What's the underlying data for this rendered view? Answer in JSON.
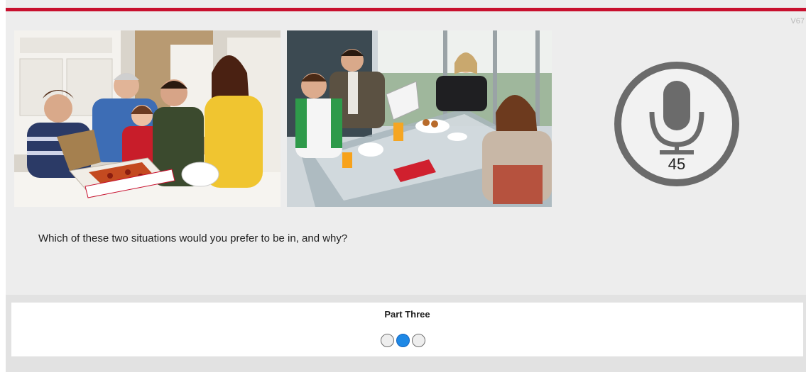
{
  "header": {
    "version": "V67",
    "accent_color": "#c8102e"
  },
  "prompt": {
    "images": [
      {
        "description_name": "family-pizza-photo"
      },
      {
        "description_name": "family-dinner-table-photo"
      }
    ],
    "question": "Which of these two situations would you prefer to be in, and why?"
  },
  "recorder": {
    "icon": "microphone-icon",
    "countdown": "45"
  },
  "footer": {
    "part_title": "Part Three",
    "progress": {
      "total": 3,
      "current": 2,
      "active_color": "#1e88e5"
    }
  }
}
